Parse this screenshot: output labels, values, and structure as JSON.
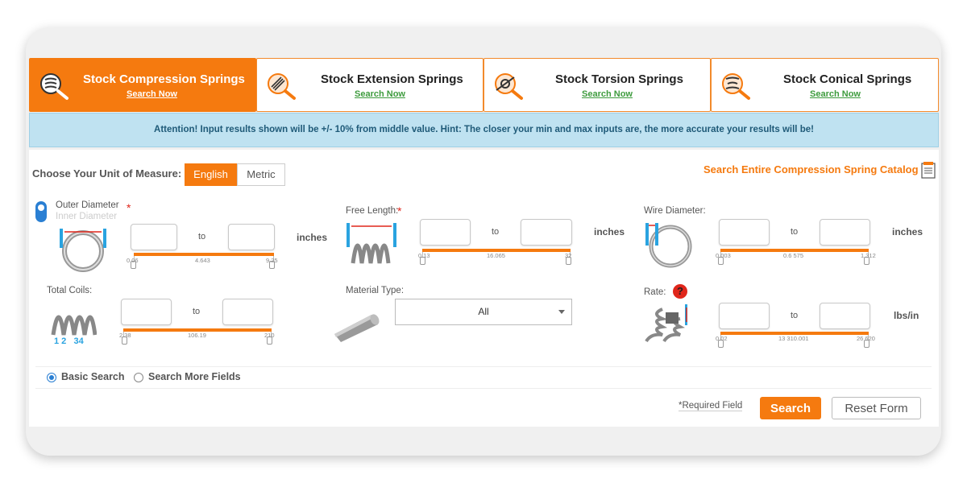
{
  "tabs": [
    {
      "title": "Stock Compression Springs",
      "link": "Search Now"
    },
    {
      "title": "Stock Extension Springs",
      "link": "Search Now"
    },
    {
      "title": "Stock Torsion Springs",
      "link": "Search Now"
    },
    {
      "title": "Stock Conical Springs",
      "link": "Search Now"
    }
  ],
  "notice": "Attention! Input results shown will be +/- 10% from middle value. Hint: The closer your min and max inputs are, the more accurate your results will be!",
  "unit_label": "Choose Your Unit of Measure:",
  "units": {
    "english": "English",
    "metric": "Metric"
  },
  "catalog_link": "Search Entire Compression Spring Catalog",
  "fields": {
    "outer_diameter": {
      "label": "Outer Diameter",
      "alt_label": "Inner Diameter",
      "req": "*",
      "to": "to",
      "unit": "inches",
      "scale_min": "0.06",
      "scale_mid": "4.643",
      "scale_max": "9.25"
    },
    "free_length": {
      "label": "Free Length:",
      "req": "*",
      "to": "to",
      "unit": "inches",
      "scale_min": "0.13",
      "scale_mid": "16.065",
      "scale_max": "32"
    },
    "wire_diameter": {
      "label": "Wire Diameter:",
      "to": "to",
      "unit": "inches",
      "scale_min": "0.003",
      "scale_mid": "0.6 575",
      "scale_max": "1.312"
    },
    "total_coils": {
      "label": "Total Coils:",
      "to": "to",
      "scale_min": "2.38",
      "scale_mid": "106.19",
      "scale_max": "210",
      "coil_numbers": "1 2   34"
    },
    "material": {
      "label": "Material Type:",
      "selected": "All"
    },
    "rate": {
      "label": "Rate:",
      "to": "to",
      "unit": "lbs/in",
      "scale_min": "0.02",
      "scale_mid": "13 310.001",
      "scale_max": "26 620",
      "help": "?"
    }
  },
  "search_options": {
    "basic": "Basic Search",
    "more": "Search More Fields"
  },
  "required_note": "*Required Field",
  "buttons": {
    "search": "Search",
    "reset": "Reset Form"
  },
  "colors": {
    "accent": "#f57a0f",
    "notice_bg": "#bfe2f1",
    "link_green": "#3d9b3d"
  }
}
